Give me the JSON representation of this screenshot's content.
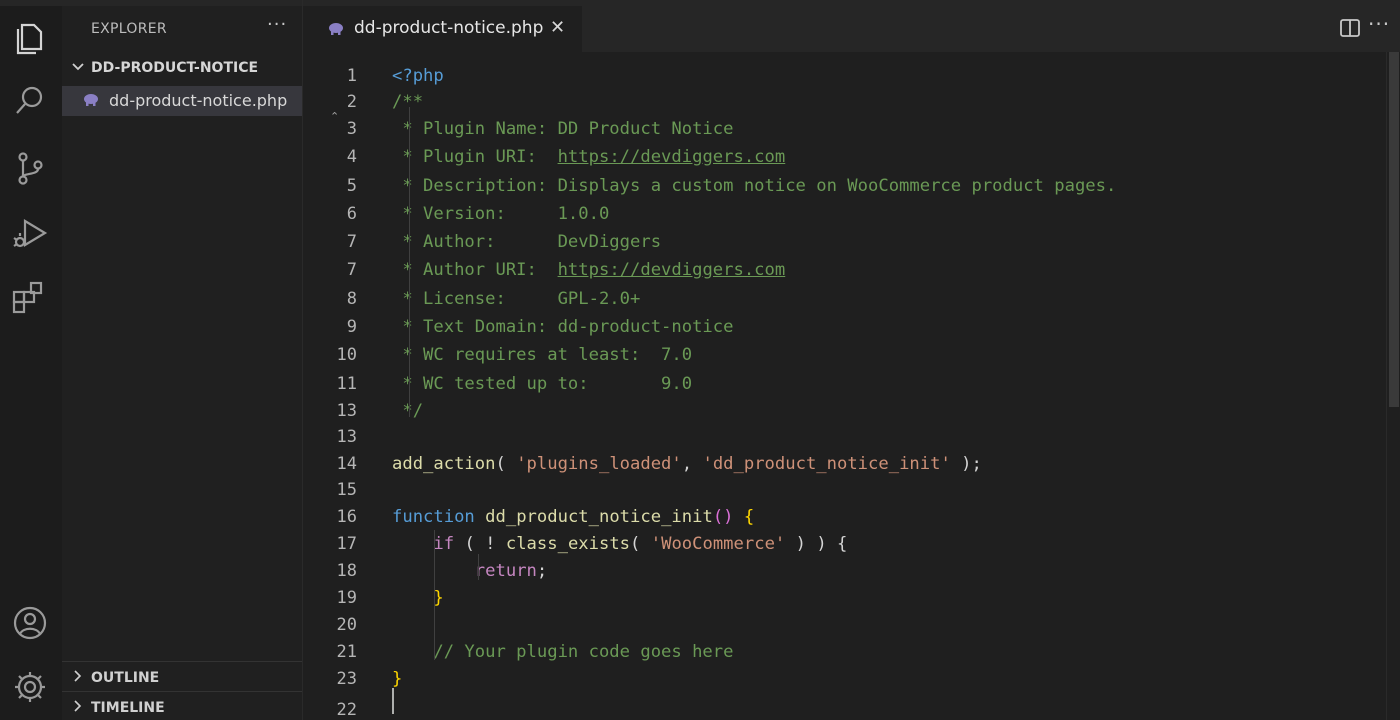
{
  "activity_bar": {
    "items": [
      {
        "name": "explorer-icon"
      },
      {
        "name": "search-icon"
      },
      {
        "name": "source-control-icon"
      },
      {
        "name": "run-debug-icon"
      },
      {
        "name": "extensions-icon"
      }
    ],
    "bottom": [
      {
        "name": "accounts-icon"
      },
      {
        "name": "settings-gear-icon"
      }
    ]
  },
  "sidebar": {
    "title": "EXPLORER",
    "more": "···",
    "folder": "DD-PRODUCT-NOTICE",
    "file": "dd-product-notice.php",
    "panels": [
      "OUTLINE",
      "TIMELINE"
    ]
  },
  "editor": {
    "tab_title": "dd-product-notice.php",
    "tab_close": "✕",
    "more": "···",
    "line_numbers": [
      "1",
      "2",
      "3",
      "4",
      "5",
      "6",
      "7",
      "7",
      "8",
      "9",
      "10",
      "11",
      "13",
      "13",
      "14",
      "15",
      "16",
      "17",
      "18",
      "19",
      "20",
      "21",
      "23",
      "22"
    ],
    "lines": [
      "<?php",
      "/**",
      " * Plugin Name: DD Product Notice",
      " * Plugin URI:  https://devdiggers.com",
      " * Description: Displays a custom notice on WooCommerce product pages.",
      " * Version:     1.0.0",
      " * Author:      DevDiggers",
      " * Author URI:  https://devdiggers.com",
      " * License:     GPL-2.0+",
      " * Text Domain: dd-product-notice",
      " * WC requires at least:  7.0",
      " * WC tested up to:       9.0",
      " */",
      "",
      "add_action( 'plugins_loaded', 'dd_product_notice_init' );",
      "",
      "function dd_product_notice_init() {",
      "    if ( ! class_exists( 'WooCommerce' ) ) {",
      "        return;",
      "    }",
      "",
      "    // Your plugin code goes here",
      "}",
      ""
    ]
  },
  "colors": {
    "background": "#1f1f1f",
    "keyword": "#569cd6",
    "comment": "#6a9955",
    "function": "#dcdcaa",
    "string": "#ce9178",
    "control": "#c586c0",
    "bracket": "#ffd700"
  }
}
